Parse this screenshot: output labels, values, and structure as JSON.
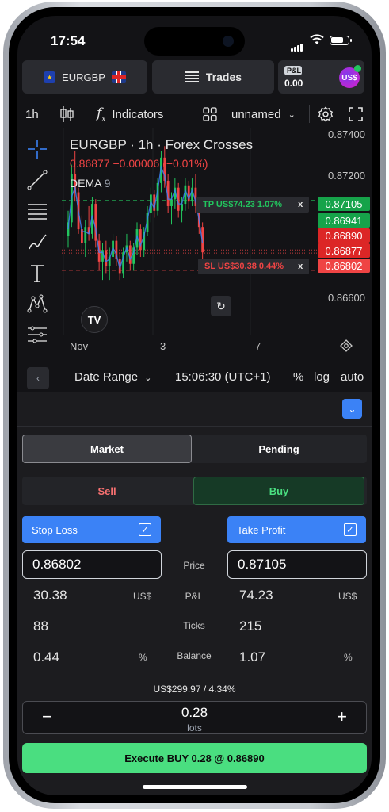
{
  "status_bar": {
    "time": "17:54"
  },
  "top_bar": {
    "symbol": "EURGBP",
    "trades_label": "Trades",
    "pnl_tag": "P&L",
    "pnl_value": "0.00",
    "avatar_text": "US$"
  },
  "toolbar": {
    "interval": "1h",
    "indicators_label": "Indicators",
    "layout_name": "unnamed"
  },
  "chart": {
    "title": "EURGBP · 1h · Forex Crosses",
    "ohlc_line": "0.86877  −0.00006 (−0.01%)",
    "indicator_name": "DEMA",
    "indicator_param": "9",
    "tp_label": "TP US$74.23 1.07%",
    "tp_close": "x",
    "sl_label": "SL US$30.38 0.44%",
    "sl_close": "x",
    "tv_logo": "TV",
    "price_ticks": [
      "0.87400",
      "0.87200",
      "0.86600"
    ],
    "price_boxes": [
      {
        "value": "0.87105",
        "color": "#16a34a"
      },
      {
        "value": "0.86941",
        "color": "#16a34a"
      },
      {
        "value": "0.86890",
        "color": "#dc2626"
      },
      {
        "value": "0.86877",
        "color": "#dc2626"
      },
      {
        "value": "0.86802",
        "color": "#ef4444"
      }
    ],
    "time_ticks": [
      "Nov",
      "3",
      "7"
    ]
  },
  "chart_data": {
    "type": "candlestick",
    "title": "EURGBP · 1h · Forex Crosses",
    "xlabel": "",
    "ylabel": "",
    "x_ticks": [
      "Nov",
      "3",
      "7"
    ],
    "y_ticks": [
      0.874,
      0.872,
      0.866
    ],
    "ylim": [
      0.8652,
      0.8742
    ],
    "grid": false,
    "candles": [
      [
        0.8695,
        0.8706,
        0.869,
        0.8701
      ],
      [
        0.8701,
        0.8726,
        0.8699,
        0.8722
      ],
      [
        0.8722,
        0.8732,
        0.871,
        0.8714
      ],
      [
        0.8714,
        0.8716,
        0.8696,
        0.8698
      ],
      [
        0.8698,
        0.8704,
        0.8688,
        0.8692
      ],
      [
        0.8692,
        0.8702,
        0.8686,
        0.8699
      ],
      [
        0.8699,
        0.8708,
        0.8693,
        0.8696
      ],
      [
        0.8696,
        0.8712,
        0.8694,
        0.8709
      ],
      [
        0.8709,
        0.8711,
        0.869,
        0.8693
      ],
      [
        0.8693,
        0.8696,
        0.868,
        0.8684
      ],
      [
        0.8684,
        0.8692,
        0.8676,
        0.8689
      ],
      [
        0.8689,
        0.8693,
        0.8679,
        0.8682
      ],
      [
        0.8682,
        0.869,
        0.8676,
        0.8686
      ],
      [
        0.8686,
        0.8696,
        0.8683,
        0.8693
      ],
      [
        0.8693,
        0.8695,
        0.8682,
        0.8685
      ],
      [
        0.8685,
        0.8688,
        0.8676,
        0.8679
      ],
      [
        0.8679,
        0.869,
        0.8677,
        0.8688
      ],
      [
        0.8688,
        0.8696,
        0.8684,
        0.8691
      ],
      [
        0.8691,
        0.8693,
        0.868,
        0.8683
      ],
      [
        0.8683,
        0.8692,
        0.868,
        0.869
      ],
      [
        0.869,
        0.8701,
        0.8687,
        0.8698
      ],
      [
        0.8698,
        0.87,
        0.8686,
        0.8689
      ],
      [
        0.8689,
        0.8699,
        0.8686,
        0.8697
      ],
      [
        0.8697,
        0.8708,
        0.8695,
        0.8705
      ],
      [
        0.8705,
        0.8716,
        0.8701,
        0.8713
      ],
      [
        0.8713,
        0.8715,
        0.8703,
        0.8706
      ],
      [
        0.8706,
        0.872,
        0.8704,
        0.8718
      ],
      [
        0.8718,
        0.8732,
        0.8714,
        0.8729
      ],
      [
        0.8729,
        0.8734,
        0.8716,
        0.8719
      ],
      [
        0.8719,
        0.8722,
        0.8705,
        0.8708
      ],
      [
        0.8708,
        0.8714,
        0.87,
        0.8711
      ],
      [
        0.8711,
        0.872,
        0.8707,
        0.8716
      ],
      [
        0.8716,
        0.8718,
        0.8703,
        0.8706
      ],
      [
        0.8706,
        0.8712,
        0.8701,
        0.8709
      ],
      [
        0.8709,
        0.872,
        0.8706,
        0.8717
      ],
      [
        0.8717,
        0.8719,
        0.8707,
        0.871
      ],
      [
        0.871,
        0.872,
        0.8708,
        0.8716
      ],
      [
        0.8716,
        0.8722,
        0.8705,
        0.8708
      ],
      [
        0.8708,
        0.8712,
        0.8696,
        0.8699
      ],
      [
        0.8699,
        0.8701,
        0.8685,
        0.8688
      ]
    ],
    "dema": [
      0.8698,
      0.8712,
      0.8716,
      0.8706,
      0.8697,
      0.8697,
      0.8696,
      0.8704,
      0.8698,
      0.8688,
      0.8688,
      0.8684,
      0.8685,
      0.869,
      0.8687,
      0.8681,
      0.8686,
      0.869,
      0.8685,
      0.8688,
      0.8695,
      0.8691,
      0.8695,
      0.8702,
      0.871,
      0.8707,
      0.8715,
      0.8725,
      0.8721,
      0.8711,
      0.8711,
      0.8715,
      0.8709,
      0.8709,
      0.8715,
      0.8711,
      0.8715,
      0.871,
      0.8702,
      0.8692
    ],
    "lines": {
      "take_profit": 0.87105,
      "stop_loss": 0.86802,
      "ask": 0.8689,
      "bid": 0.86877
    }
  },
  "range_bar": {
    "date_range_label": "Date Range",
    "clock": "15:06:30 (UTC+1)",
    "percent": "%",
    "log": "log",
    "auto": "auto"
  },
  "order_panel": {
    "tabs": [
      "Market",
      "Pending"
    ],
    "sides": [
      "Sell",
      "Buy"
    ],
    "stop_loss_label": "Stop Loss",
    "take_profit_label": "Take Profit",
    "check_mark": "✓",
    "sl_price": "0.86802",
    "tp_price": "0.87105",
    "row_labels": [
      "Price",
      "P&L",
      "Ticks",
      "Balance"
    ],
    "sl_pnl": "30.38",
    "tp_pnl": "74.23",
    "pnl_unit": "US$",
    "sl_ticks": "88",
    "tp_ticks": "215",
    "sl_balance": "0.44",
    "tp_balance": "1.07",
    "balance_unit": "%",
    "summary": "US$299.97 / 4.34%",
    "lots_value": "0.28",
    "lots_unit": "lots",
    "minus": "−",
    "plus": "+",
    "execute_label": "Execute BUY 0.28 @ 0.86890"
  },
  "colors": {
    "up": "#22c55e",
    "down": "#ef4444",
    "accent": "#3b82f6",
    "buy": "#4ade80"
  }
}
